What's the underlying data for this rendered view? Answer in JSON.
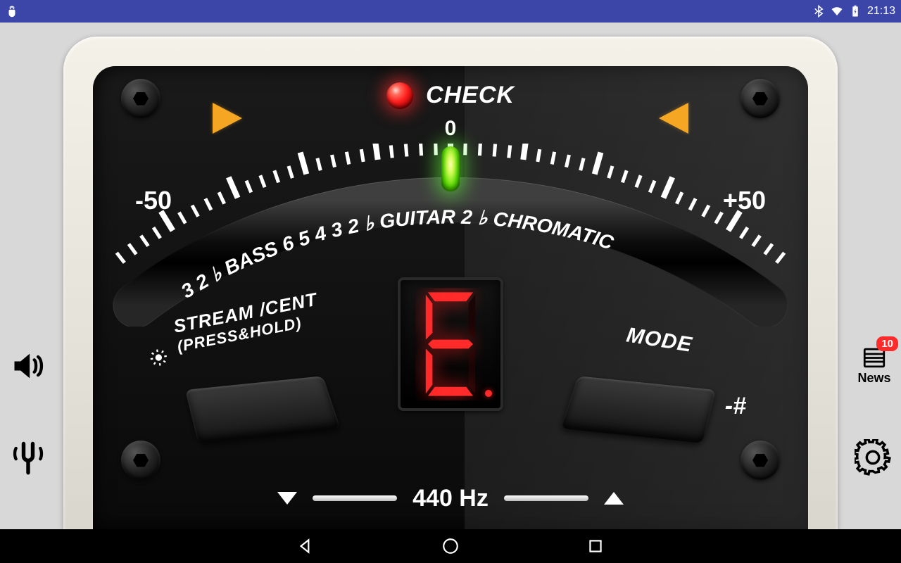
{
  "statusbar": {
    "time": "21:13",
    "icons": [
      "bluetooth",
      "wifi",
      "battery-charging"
    ]
  },
  "tuner": {
    "check_label": "CHECK",
    "zero_label": "0",
    "min_cents": "-50",
    "max_cents": "+50",
    "scale_labels_lower": [
      "3",
      "2",
      "♭",
      "BASS",
      "6",
      "5",
      "4",
      "3",
      "2",
      "♭",
      "GUITAR",
      "2",
      "♭",
      "CHROMATIC"
    ],
    "stream_label_top": "STREAM /CENT",
    "stream_label_sub": "(PRESS&HOLD)",
    "mode_label": "MODE",
    "note": "E",
    "accidental": "-#",
    "reference_hz": "440 Hz"
  },
  "side": {
    "news_label": "News",
    "news_badge": "10"
  }
}
